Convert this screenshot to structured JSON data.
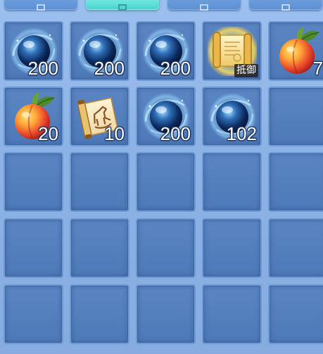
{
  "tabs": [
    {
      "icon": "tab-icon-1",
      "active": false
    },
    {
      "icon": "tab-icon-2",
      "active": true
    },
    {
      "icon": "tab-icon-3",
      "active": false
    },
    {
      "icon": "tab-icon-4",
      "active": false
    }
  ],
  "inventory": {
    "rows": 5,
    "columns": 5,
    "slots": [
      {
        "item": "blue-orb",
        "count": "200",
        "tag": ""
      },
      {
        "item": "blue-orb",
        "count": "200",
        "tag": ""
      },
      {
        "item": "blue-orb",
        "count": "200",
        "tag": ""
      },
      {
        "item": "golden-scroll",
        "count": "",
        "tag": "抵御"
      },
      {
        "item": "peach",
        "count": "7",
        "tag": ""
      },
      {
        "item": "peach",
        "count": "20",
        "tag": ""
      },
      {
        "item": "horse-scroll",
        "count": "10",
        "tag": ""
      },
      {
        "item": "blue-orb",
        "count": "200",
        "tag": ""
      },
      {
        "item": "blue-orb",
        "count": "102",
        "tag": ""
      },
      {
        "item": "",
        "count": "",
        "tag": ""
      },
      {
        "item": "",
        "count": "",
        "tag": ""
      },
      {
        "item": "",
        "count": "",
        "tag": ""
      },
      {
        "item": "",
        "count": "",
        "tag": ""
      },
      {
        "item": "",
        "count": "",
        "tag": ""
      },
      {
        "item": "",
        "count": "",
        "tag": ""
      },
      {
        "item": "",
        "count": "",
        "tag": ""
      },
      {
        "item": "",
        "count": "",
        "tag": ""
      },
      {
        "item": "",
        "count": "",
        "tag": ""
      },
      {
        "item": "",
        "count": "",
        "tag": ""
      },
      {
        "item": "",
        "count": "",
        "tag": ""
      },
      {
        "item": "",
        "count": "",
        "tag": ""
      },
      {
        "item": "",
        "count": "",
        "tag": ""
      },
      {
        "item": "",
        "count": "",
        "tag": ""
      },
      {
        "item": "",
        "count": "",
        "tag": ""
      },
      {
        "item": "",
        "count": "",
        "tag": ""
      }
    ]
  }
}
